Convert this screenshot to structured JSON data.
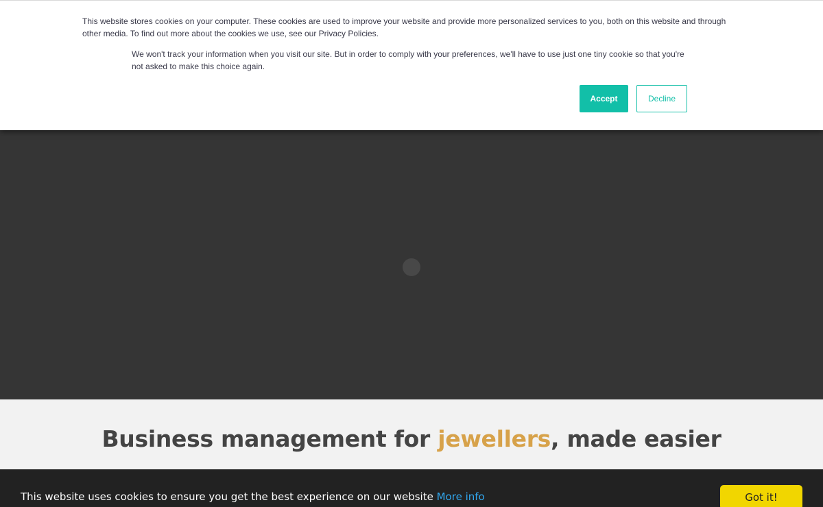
{
  "consent_banner": {
    "message": "This website stores cookies on your computer. These cookies are used to improve your website and provide more personalized services to you, both on this website and through other media. To find out more about the cookies we use, see our Privacy Policies.",
    "secondary_message": "We won't track your information when you visit our site. But in order to comply with your preferences, we'll have to use just one tiny cookie so that you're not asked to make this choice again.",
    "accept_label": "Accept",
    "decline_label": "Decline"
  },
  "hero": {
    "loading_indicator": "spinner-icon"
  },
  "headline": {
    "prefix": "Business management for ",
    "accent": "jewellers",
    "suffix": ", made easier"
  },
  "cookie_bar": {
    "text": "This website uses cookies to ensure you get the best experience on our website ",
    "more_info_label": "More info",
    "got_it_label": "Got it!"
  },
  "colors": {
    "accept_bg": "#12bfa8",
    "accent_gold": "#d7a24a",
    "link_blue": "#31a8f0",
    "got_it_bg": "#f1d600",
    "hero_bg": "#353535"
  }
}
